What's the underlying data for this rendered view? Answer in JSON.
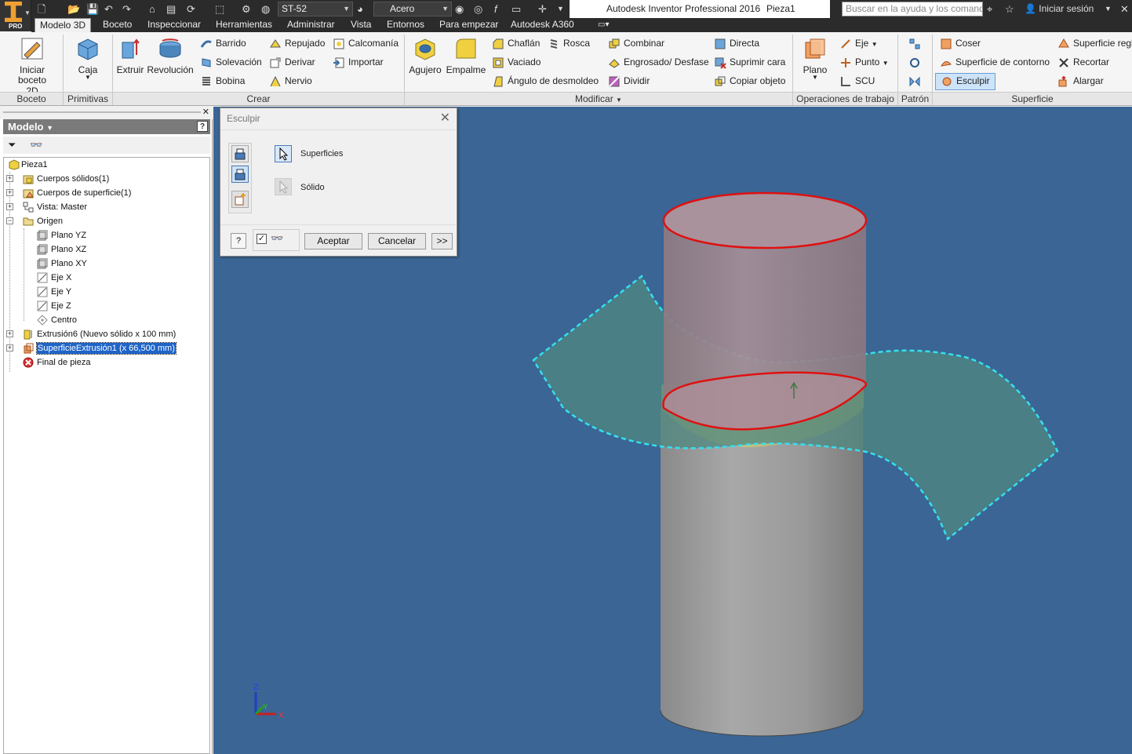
{
  "titlebar": {
    "material": "ST-52",
    "appearance": "Acero",
    "app_title": "Autodesk Inventor Professional 2016",
    "doc_title": "Pieza1",
    "help_placeholder": "Buscar en la ayuda y los comandos",
    "signin": "Iniciar sesión",
    "logo_badge": "PRO"
  },
  "tabs": [
    "Modelo 3D",
    "Boceto",
    "Inspeccionar",
    "Herramientas",
    "Administrar",
    "Vista",
    "Entornos",
    "Para empezar",
    "Autodesk A360"
  ],
  "ribbon": {
    "iniciar_boceto": [
      "Iniciar",
      "boceto 2D"
    ],
    "caja": "Caja",
    "extruir": "Extruir",
    "revolucion": "Revolución",
    "barrido": "Barrido",
    "solevacion": "Solevación",
    "bobina": "Bobina",
    "repujado": "Repujado",
    "derivar": "Derivar",
    "nervio": "Nervio",
    "calcomania": "Calcomanía",
    "importar": "Importar",
    "agujero": "Agujero",
    "empalme": "Empalme",
    "chaflan": "Chaflán",
    "rosca": "Rosca",
    "vaciado": "Vaciado",
    "angulo": "Ángulo de desmoldeo",
    "combinar": "Combinar",
    "engrosado": "Engrosado/ Desfase",
    "dividir": "Dividir",
    "directa": "Directa",
    "suprimir": "Suprimir cara",
    "copiar": "Copiar objeto",
    "plano": "Plano",
    "eje": "Eje",
    "punto": "Punto",
    "scu": "SCU",
    "coser": "Coser",
    "sup_contorno": "Superficie de contorno",
    "esculpir": "Esculpir",
    "sup_reglada": "Superficie reglada",
    "recortar": "Recortar",
    "alargar": "Alargar",
    "panels": [
      "Boceto",
      "Primitivas",
      "Crear",
      "Modificar",
      "Operaciones de trabajo",
      "Patrón",
      "Superficie"
    ]
  },
  "model": {
    "header": "Modelo",
    "tree": [
      "Pieza1",
      "Cuerpos sólidos(1)",
      "Cuerpos de superficie(1)",
      "Vista: Master",
      "Origen",
      "Plano YZ",
      "Plano XZ",
      "Plano XY",
      "Eje X",
      "Eje Y",
      "Eje Z",
      "Centro",
      "Extrusión6 (Nuevo sólido x 100 mm)",
      "SuperficieExtrusión1 (x 66,500 mm)",
      "Final de pieza"
    ]
  },
  "dialog": {
    "title": "Esculpir",
    "superficies": "Superficies",
    "solido": "Sólido",
    "accept": "Aceptar",
    "cancel": "Cancelar",
    "more": ">>",
    "help": "?"
  },
  "triad": {
    "z": "Z",
    "y": "Y",
    "x": "X"
  },
  "colors": {
    "viewport": "#3a6594",
    "highlight_red": "#e01010",
    "surface_dash": "#30d8e8",
    "selection": "#1e64c8"
  }
}
